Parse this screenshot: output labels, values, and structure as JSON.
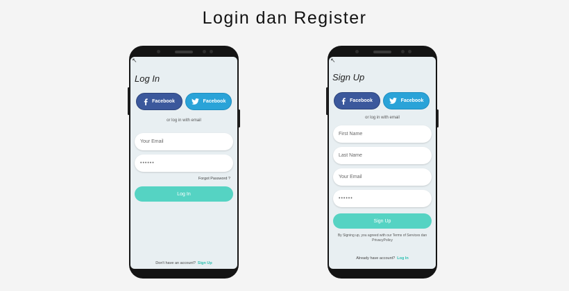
{
  "page": {
    "title": "Login dan Register"
  },
  "login": {
    "back_icon": "back-arrow-icon",
    "title": "Log In",
    "facebook_label": "Facebook",
    "twitter_label": "Facebook",
    "hint": "or log in with email",
    "email_placeholder": "Your Email",
    "password_value": "••••••",
    "forgot": "Forgot Password ?",
    "submit": "Log In",
    "footer_text": "Don't have an account?",
    "footer_link": "Sign Up"
  },
  "signup": {
    "back_icon": "back-arrow-icon",
    "title": "Sign Up",
    "facebook_label": "Facebook",
    "twitter_label": "Facebook",
    "hint": "or log in with email",
    "first_name_placeholder": "First Name",
    "last_name_placeholder": "Last Name",
    "email_placeholder": "Your Email",
    "password_value": "••••••",
    "submit": "Sign Up",
    "terms": "By Signing up, you agreed with our Terms of Services dan PrivacyPolicy",
    "footer_text": "Already have account?",
    "footer_link": "Log In"
  },
  "colors": {
    "facebook": "#3b589c",
    "twitter": "#2aa3d8",
    "accent": "#55d3c3",
    "screen_bg": "#e8eff2"
  }
}
